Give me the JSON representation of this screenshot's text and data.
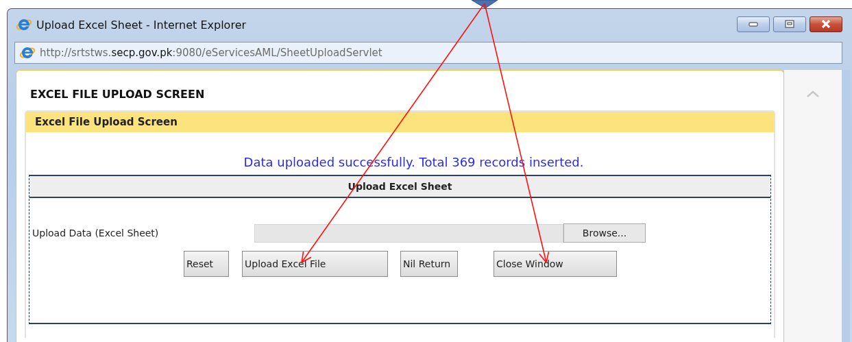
{
  "window": {
    "title": "Upload Excel Sheet - Internet Explorer"
  },
  "address_bar": {
    "prefix": "http://srtstws.",
    "domain": "secp.gov.pk",
    "suffix": ":9080/eServicesAML/SheetUploadServlet"
  },
  "page": {
    "heading": "EXCEL FILE UPLOAD SCREEN",
    "panel_title": "Excel File Upload Screen",
    "message": "Data uploaded successfully. Total 369 records inserted.",
    "form": {
      "title": "Upload Excel Sheet",
      "field_label": "Upload Data (Excel Sheet)",
      "browse_button": "Browse...",
      "buttons": [
        "Reset",
        "Upload Excel File",
        "Nil Return",
        "Close Window"
      ]
    }
  },
  "annotations": [
    {
      "kind": "arrow"
    },
    {
      "kind": "arrow"
    }
  ]
}
